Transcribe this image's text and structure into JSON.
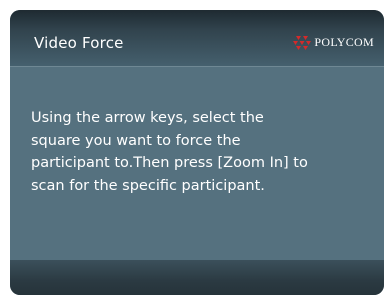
{
  "dialog": {
    "title": "Video Force",
    "brand": "POLYCOM",
    "message": "Using the arrow keys, select the\nsquare you want to force the\nparticipant to.Then press [Zoom In] to\nscan for the specific participant."
  },
  "colors": {
    "panel": "#55717f",
    "header_dark": "#1e2a31",
    "brand_red": "#d42a2a",
    "text": "#ffffff"
  },
  "icons": {
    "brand_logo": "polycom-triangle-logo-icon"
  }
}
